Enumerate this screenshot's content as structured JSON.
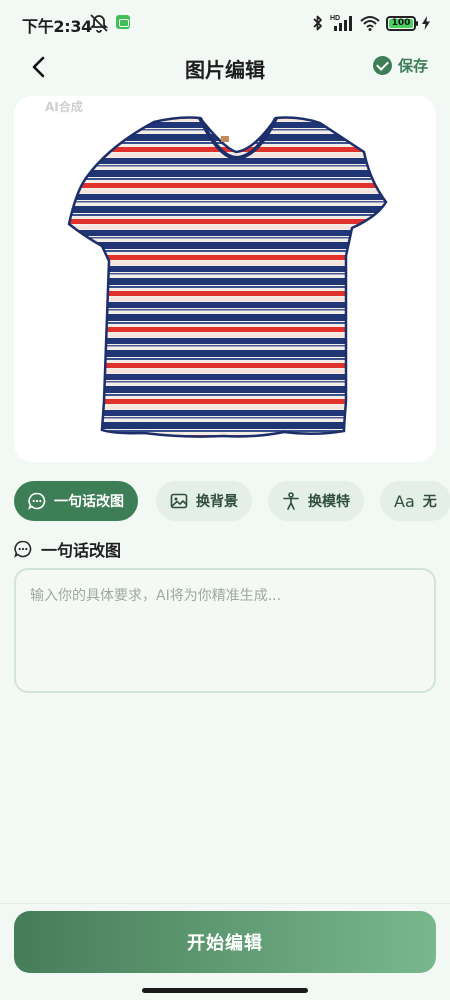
{
  "status_bar": {
    "time": "下午2:34",
    "battery": "100",
    "network_label": "HD"
  },
  "header": {
    "title": "图片编辑",
    "save_label": "保存"
  },
  "image": {
    "badge": "AI合成",
    "subject": "striped-tshirt"
  },
  "tabs": [
    {
      "label": "一句话改图",
      "icon": "chat-bubble-icon",
      "active": true
    },
    {
      "label": "换背景",
      "icon": "image-icon",
      "active": false
    },
    {
      "label": "换模特",
      "icon": "person-icon",
      "active": false
    },
    {
      "label": "无",
      "icon": "font-icon",
      "active": false
    }
  ],
  "tab_font_icon_text": "Aa",
  "section": {
    "title": "一句话改图"
  },
  "prompt": {
    "value": "",
    "placeholder": "输入你的具体要求，AI将为你精准生成..."
  },
  "action": {
    "start_label": "开始编辑"
  },
  "colors": {
    "accent": "#3d7e57",
    "gradient_start": "#467d59",
    "gradient_end": "#79b88c",
    "background": "#f2f8f3"
  }
}
